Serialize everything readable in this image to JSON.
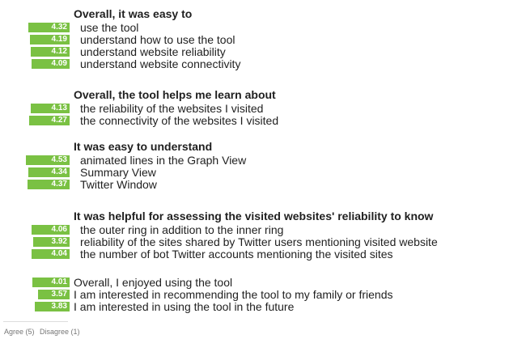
{
  "chart_data": {
    "type": "bar",
    "orientation": "horizontal",
    "color": "#7ac143",
    "axis": {
      "left_label": "Agree (5)",
      "right_label": "Disagree (1)",
      "range": [
        1,
        5
      ]
    },
    "groups": [
      {
        "title": "Overall, it was easy to",
        "items": [
          {
            "label": "use the tool",
            "value": 4.32
          },
          {
            "label": "understand how to use the tool",
            "value": 4.19
          },
          {
            "label": "understand website reliability",
            "value": 4.12
          },
          {
            "label": "understand website connectivity",
            "value": 4.09
          }
        ]
      },
      {
        "title": "Overall, the tool helps me learn about",
        "items": [
          {
            "label": "the reliability of the websites I visited",
            "value": 4.13
          },
          {
            "label": "the connectivity of the websites I visited",
            "value": 4.27
          }
        ]
      },
      {
        "title": "It was easy to understand",
        "items": [
          {
            "label": "animated lines in the Graph View",
            "value": 4.53
          },
          {
            "label": "Summary View",
            "value": 4.34
          },
          {
            "label": "Twitter Window",
            "value": 4.37
          }
        ]
      },
      {
        "title": "It was helpful for assessing the visited websites' reliability to know",
        "items": [
          {
            "label": "the outer ring in addition to the inner ring",
            "value": 4.06
          },
          {
            "label": "reliability of the sites shared by Twitter users mentioning visited website",
            "value": 3.92
          },
          {
            "label": "the number of bot Twitter accounts mentioning the visited sites",
            "value": 4.04
          }
        ]
      },
      {
        "title": "",
        "items": [
          {
            "label": "Overall, I enjoyed using the tool",
            "value": 4.01
          },
          {
            "label": "I am interested in recommending the tool to my family or friends",
            "value": 3.57
          },
          {
            "label": "I am interested in using the tool in the future",
            "value": 3.83
          }
        ]
      }
    ]
  }
}
